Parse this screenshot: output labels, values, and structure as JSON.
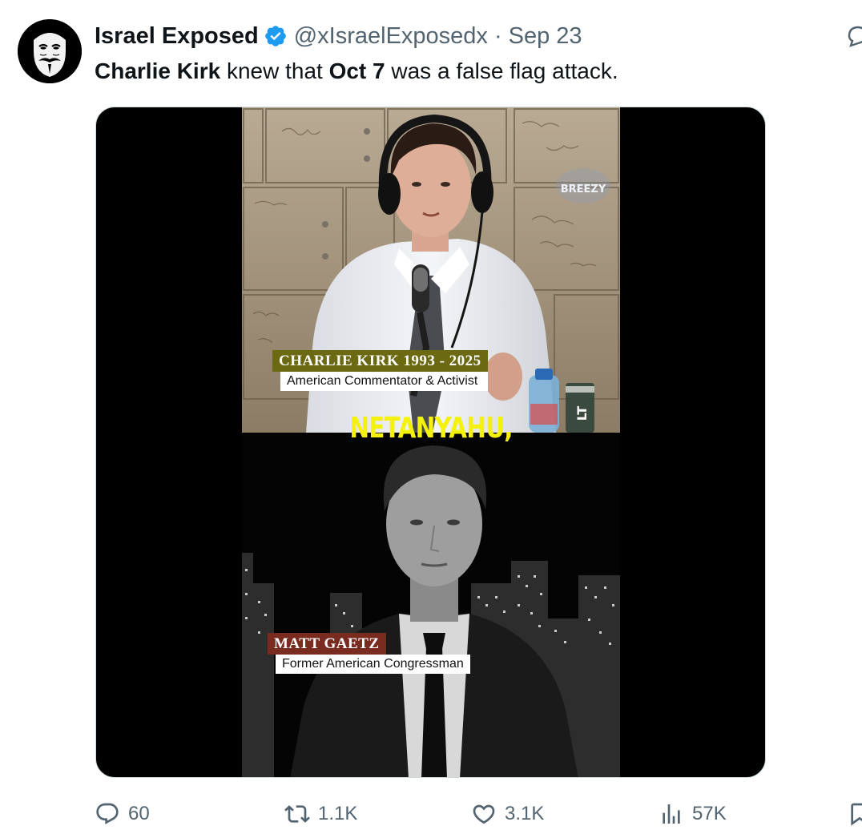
{
  "tweet": {
    "display_name": "Israel Exposed",
    "handle": "@xIsraelExposedx",
    "separator": "·",
    "date": "Sep 23",
    "text": {
      "part1": "Charlie Kirk",
      "part2": " knew that ",
      "part3": "Oct 7",
      "part4": " was a false flag attack."
    }
  },
  "media": {
    "caption": "NETANYAHU,",
    "lower_third_1": {
      "name": "CHARLIE KIRK 1993 - 2025",
      "subtitle": "American Commentator & Activist"
    },
    "lower_third_2": {
      "name": "MATT GAETZ",
      "subtitle": "Former American Congressman"
    },
    "watermark": "BREEZY"
  },
  "actions": {
    "replies": "60",
    "reposts": "1.1K",
    "likes": "3.1K",
    "views": "57K"
  },
  "colors": {
    "verified_blue": "#1d9bf0",
    "secondary_text": "#536471",
    "caption_yellow": "#f4f20a"
  },
  "icons": {
    "avatar": "guy-fawkes-mask",
    "verified": "verified-badge-icon",
    "reply": "reply-icon",
    "retweet": "retweet-icon",
    "like": "heart-icon",
    "views": "bar-chart-icon",
    "bookmark": "bookmark-icon",
    "grok": "grok-icon"
  }
}
